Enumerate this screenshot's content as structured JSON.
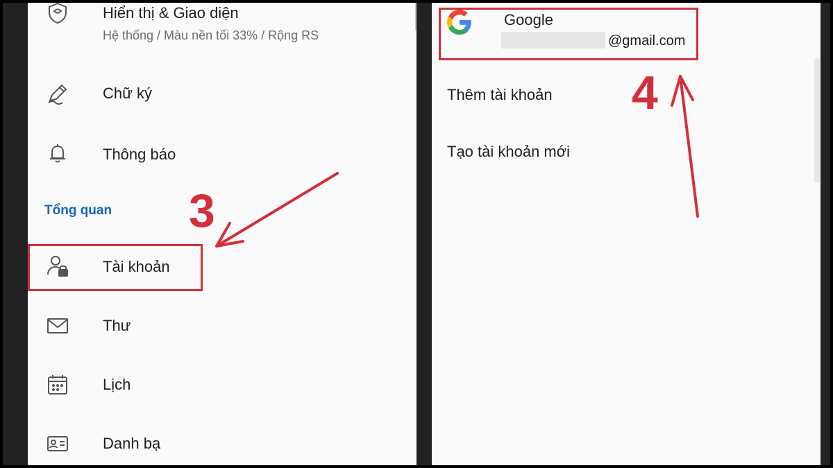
{
  "settings_menu": {
    "items": [
      {
        "label": "Hiển thị & Giao diện",
        "sub": "Hệ thống / Màu nền tối 33% / Rộng RS",
        "icon": "display-shield-icon"
      },
      {
        "label": "Chữ ký",
        "icon": "pen-icon"
      },
      {
        "label": "Thông báo",
        "icon": "bell-icon"
      },
      {
        "label": "Tài khoản",
        "icon": "account-lock-icon"
      },
      {
        "label": "Thư",
        "icon": "mail-icon"
      },
      {
        "label": "Lịch",
        "icon": "calendar-icon"
      },
      {
        "label": "Danh bạ",
        "icon": "contact-card-icon"
      }
    ],
    "section_header": "Tổng quan"
  },
  "accounts_panel": {
    "google_account": {
      "provider": "Google",
      "email_suffix": "@gmail.com"
    },
    "add_account": "Thêm tài khoản",
    "create_account": "Tạo tài khoản mới"
  },
  "annotations": {
    "step3": "3",
    "step4": "4",
    "color": "#d32f3a"
  },
  "colors": {
    "accent_blue": "#1565c0",
    "panel_bg": "#fafafa",
    "text": "#1f1f1f"
  }
}
